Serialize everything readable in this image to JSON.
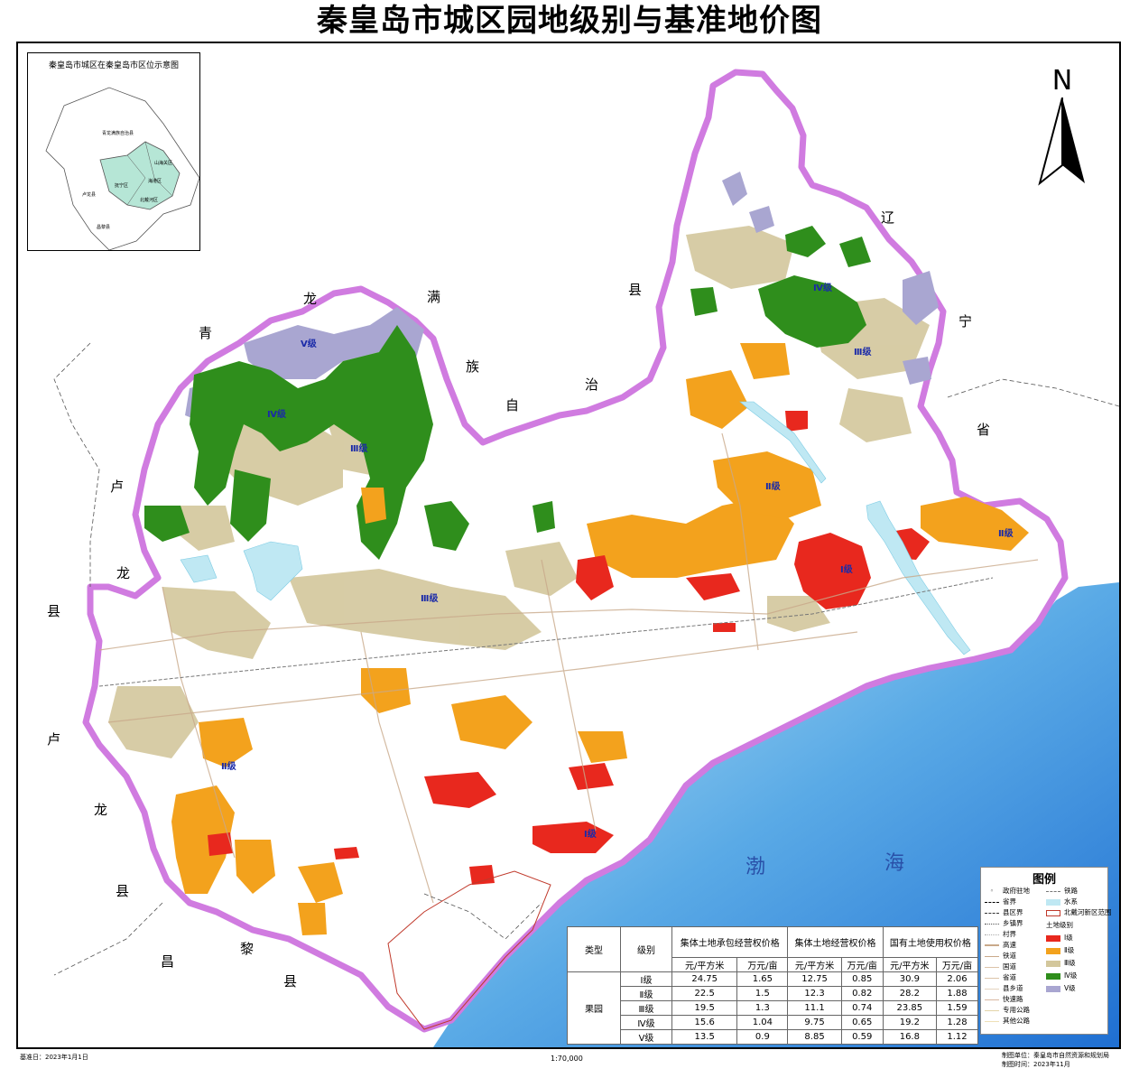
{
  "title": "秦皇岛市城区园地级别与基准地价图",
  "inset": {
    "title": "秦皇岛市城区在秦皇岛市区位示意图",
    "labels": [
      "青龙满族自治县",
      "抚宁区",
      "卢龙县",
      "海港区",
      "北戴河区",
      "山海关区",
      "昌黎县"
    ]
  },
  "north_label": "N",
  "regions": {
    "qinglong": [
      "青",
      "龙",
      "满",
      "族",
      "自",
      "治",
      "县"
    ],
    "liaoning": [
      "辽",
      "宁",
      "省"
    ],
    "lulong_w": [
      "卢",
      "龙",
      "县"
    ],
    "lulong_sw": [
      "卢",
      "龙",
      "县"
    ],
    "changli": [
      "昌",
      "黎",
      "县"
    ]
  },
  "grades": {
    "g5": "Ⅴ级",
    "g4_w": "Ⅳ级",
    "g3_w": "Ⅲ级",
    "g4_n": "Ⅳ级",
    "g3_n": "Ⅲ级",
    "g2_n": "Ⅱ级",
    "g1_e": "Ⅰ级",
    "g2_e": "Ⅱ级",
    "g3_c": "Ⅲ级",
    "g2_w": "Ⅱ级",
    "g1_s": "Ⅰ级"
  },
  "sea": [
    "渤",
    "海"
  ],
  "legend": {
    "title": "图例",
    "col1": [
      "政府驻地",
      "省界",
      "县区界",
      "乡镇界",
      "村界",
      "高速",
      "铁道",
      "国道",
      "省道",
      "县乡道",
      "快速路",
      "专用公路",
      "其他公路"
    ],
    "col2": [
      "铁路",
      "水系",
      "北戴河新区范围",
      "土地级别"
    ],
    "levels": [
      {
        "label": "Ⅰ级",
        "color": "#e8281e"
      },
      {
        "label": "Ⅱ级",
        "color": "#f3a21d"
      },
      {
        "label": "Ⅲ级",
        "color": "#d3c79c"
      },
      {
        "label": "Ⅳ级",
        "color": "#2f8e1c"
      },
      {
        "label": "Ⅴ级",
        "color": "#a9a6d1"
      }
    ]
  },
  "table": {
    "type_header": "类型",
    "grade_header": "级别",
    "groups": [
      "集体土地承包经营权价格",
      "集体土地经营权价格",
      "国有土地使用权价格"
    ],
    "units": [
      "元/平方米",
      "万元/亩",
      "元/平方米",
      "万元/亩",
      "元/平方米",
      "万元/亩"
    ],
    "type_value": "果园",
    "rows": [
      {
        "grade": "Ⅰ级",
        "values": [
          "24.75",
          "1.65",
          "12.75",
          "0.85",
          "30.9",
          "2.06"
        ]
      },
      {
        "grade": "Ⅱ级",
        "values": [
          "22.5",
          "1.5",
          "12.3",
          "0.82",
          "28.2",
          "1.88"
        ]
      },
      {
        "grade": "Ⅲ级",
        "values": [
          "19.5",
          "1.3",
          "11.1",
          "0.74",
          "23.85",
          "1.59"
        ]
      },
      {
        "grade": "Ⅳ级",
        "values": [
          "15.6",
          "1.04",
          "9.75",
          "0.65",
          "19.2",
          "1.28"
        ]
      },
      {
        "grade": "Ⅴ级",
        "values": [
          "13.5",
          "0.9",
          "8.85",
          "0.59",
          "16.8",
          "1.12"
        ]
      }
    ]
  },
  "footer": {
    "left": "基准日：2023年1月1日",
    "scale": "1:70,000",
    "right1": "制图单位：秦皇岛市自然资源和规划局",
    "right2": "制图时间：2023年11月"
  },
  "colors": {
    "grade1": "#e8281e",
    "grade2": "#f3a21d",
    "grade3": "#d3c79c",
    "grade4": "#2f8e1c",
    "grade5": "#a9a6d1",
    "boundary": "#d07be0",
    "sea": "#4b9be3",
    "water": "#bfe8f3"
  }
}
